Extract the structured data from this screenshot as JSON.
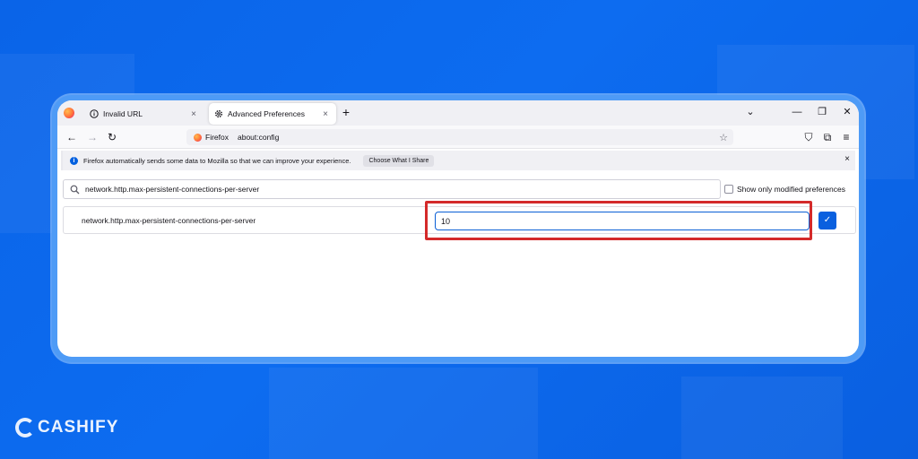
{
  "tabs": [
    {
      "label": "Invalid URL",
      "icon": "info-circle-icon",
      "close": "×"
    },
    {
      "label": "Advanced Preferences",
      "icon": "gear-icon",
      "close": "×"
    }
  ],
  "new_tab": "+",
  "window_controls": {
    "chevron": "⌄",
    "minimize": "—",
    "restore": "❐",
    "close": "✕"
  },
  "nav": {
    "back": "←",
    "forward": "→",
    "reload": "↻",
    "pocket": "⛉",
    "extensions": "⧉",
    "menu": "≡"
  },
  "urlbar": {
    "brand": "Firefox",
    "url": "about:config",
    "bookmark": "☆"
  },
  "notification": {
    "icon": "i",
    "text": "Firefox automatically sends some data to Mozilla so that we can improve your experience.",
    "button": "Choose What I Share",
    "close": "×"
  },
  "search": {
    "value": "network.http.max-persistent-connections-per-server"
  },
  "modified_filter": {
    "label": "Show only modified preferences",
    "checked": false
  },
  "preference": {
    "name": "network.http.max-persistent-connections-per-server",
    "value": "10",
    "save_icon": "✓"
  },
  "highlight_color": "#d42a2a",
  "watermark": {
    "name": "CASHIFY"
  },
  "colors": {
    "background": "#0a64e8",
    "accent": "#0a60df"
  }
}
